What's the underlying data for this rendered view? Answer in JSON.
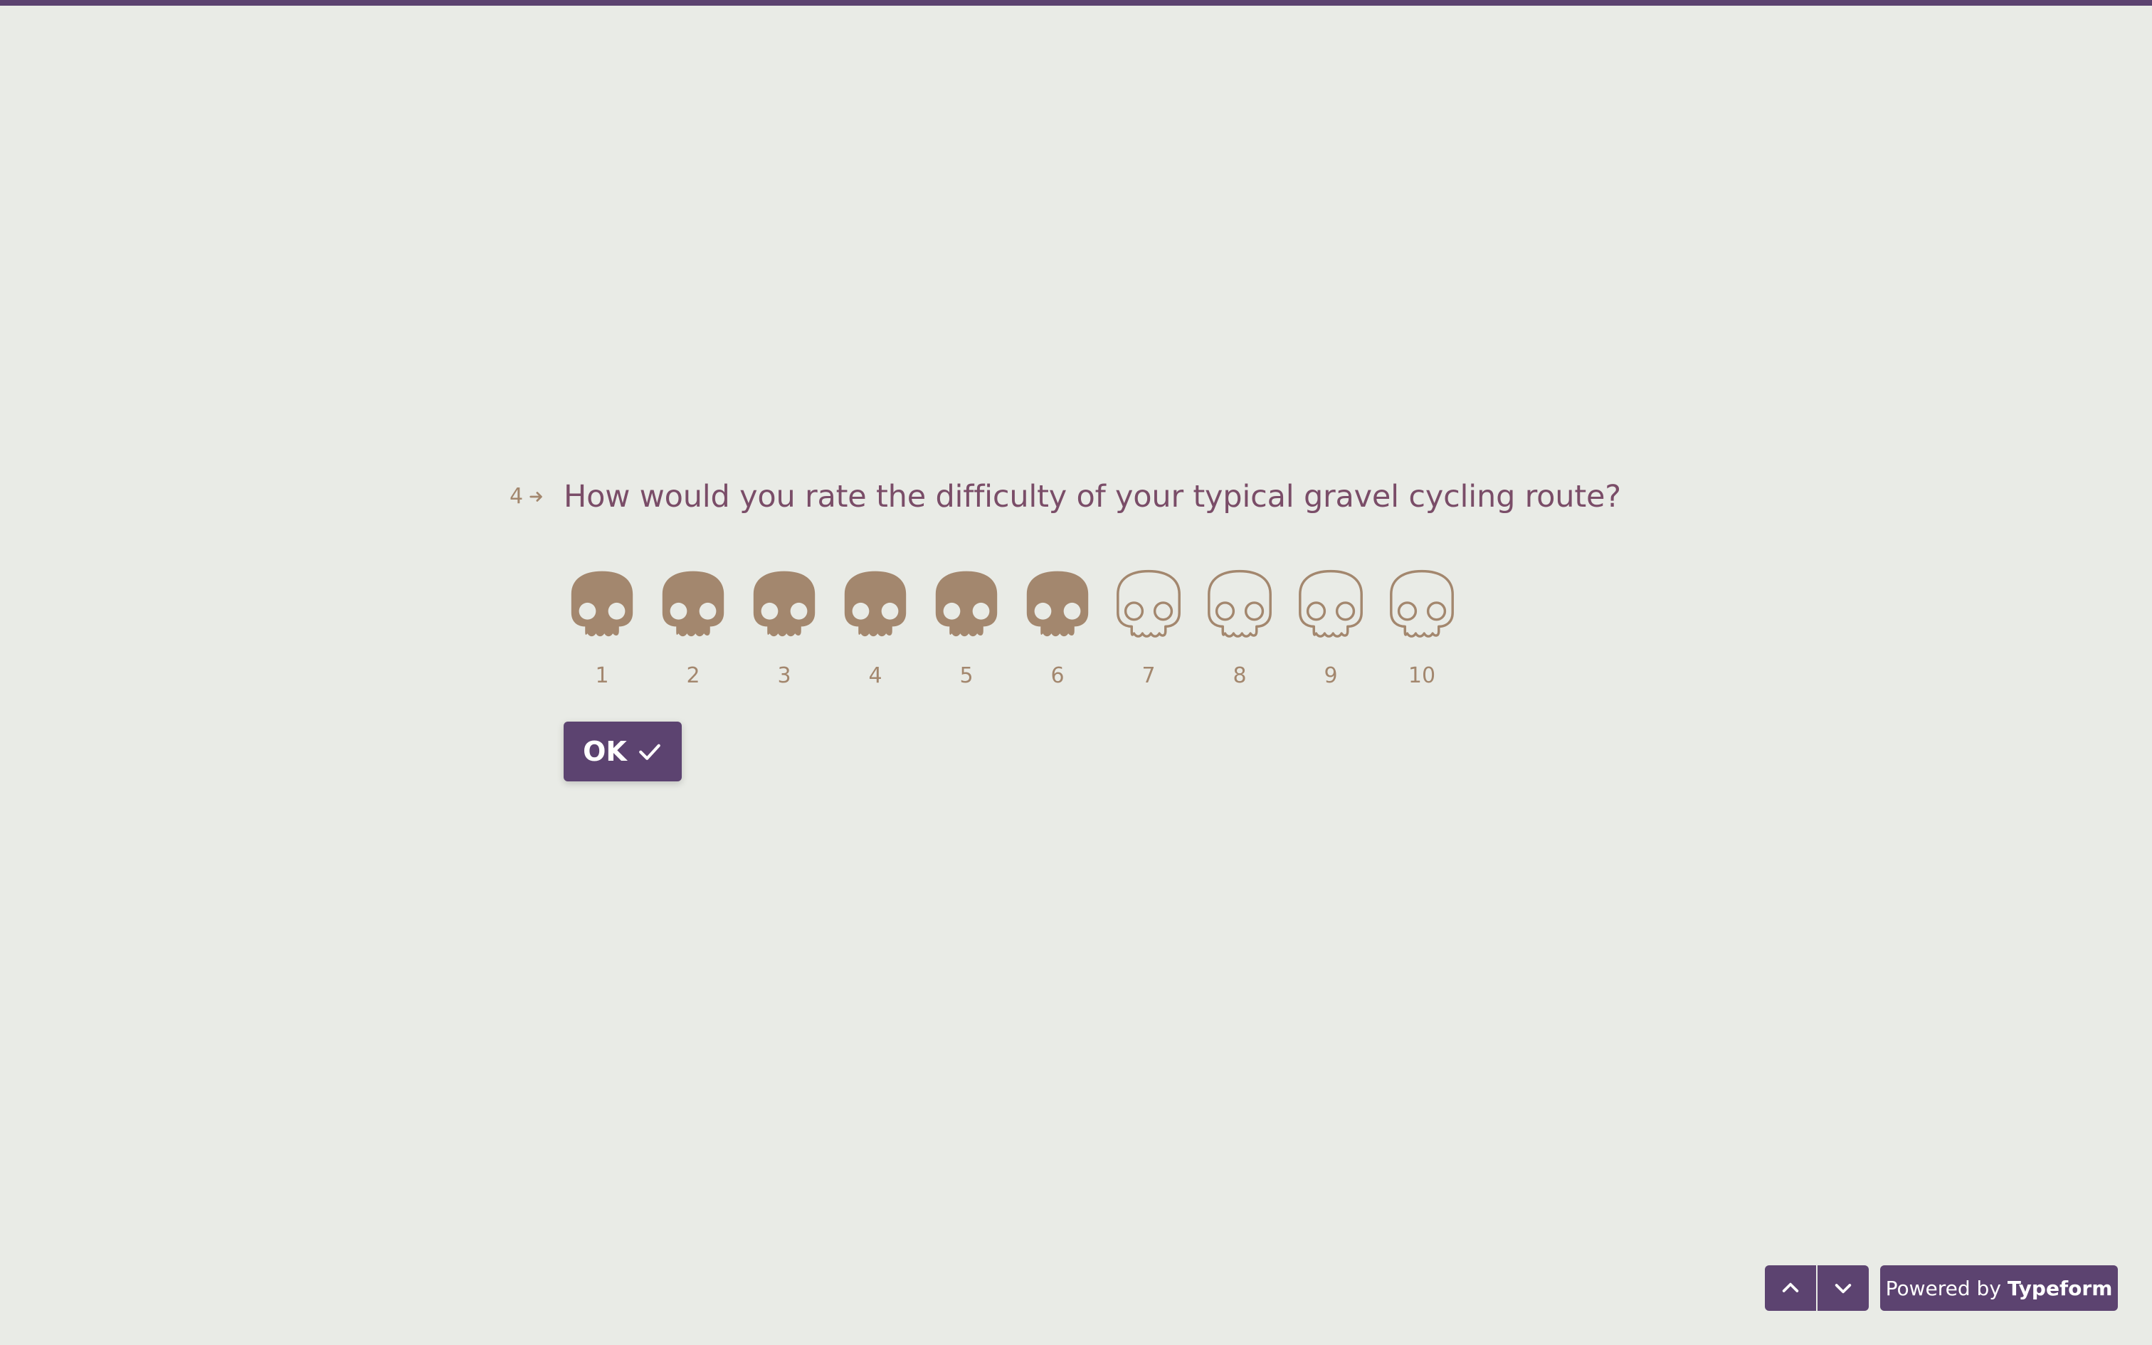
{
  "colors": {
    "background": "#e9ebe6",
    "accent": "#5c4370",
    "question_text": "#7a4d68",
    "icon_color": "#a3876e"
  },
  "question": {
    "number": "4",
    "number_icon": "arrow-right-icon",
    "text": "How would you rate the difficulty of your typical gravel cycling route?"
  },
  "rating": {
    "icon": "skull-icon",
    "selected_value": 6,
    "max": 10,
    "options": [
      "1",
      "2",
      "3",
      "4",
      "5",
      "6",
      "7",
      "8",
      "9",
      "10"
    ]
  },
  "ok_button": {
    "label": "OK",
    "icon": "check-icon"
  },
  "footer": {
    "nav_up_icon": "chevron-up-icon",
    "nav_down_icon": "chevron-down-icon",
    "powered_prefix": "Powered by",
    "powered_brand": "Typeform"
  }
}
